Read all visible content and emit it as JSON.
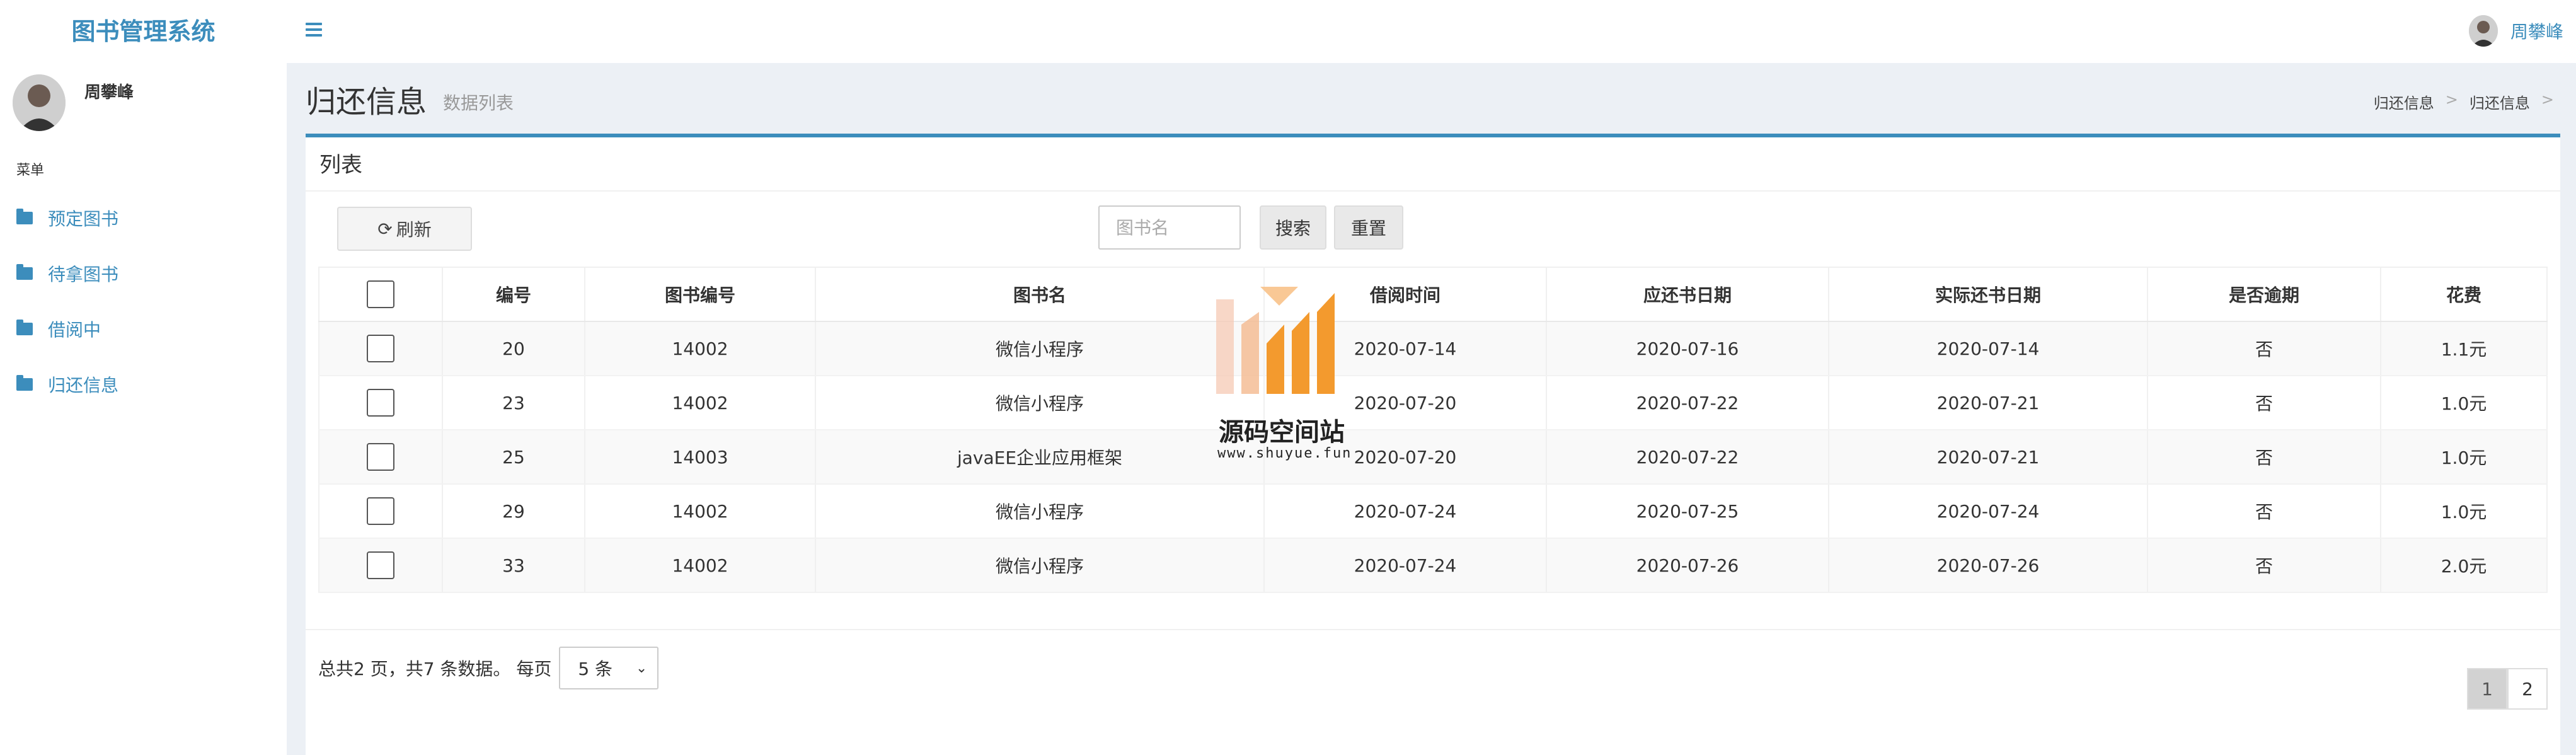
{
  "app": {
    "title": "图书管理系统"
  },
  "user": {
    "name": "周攀峰"
  },
  "sidebar": {
    "menu_header": "菜单",
    "items": [
      {
        "label": "预定图书",
        "icon": "folder-icon"
      },
      {
        "label": "待拿图书",
        "icon": "folder-icon"
      },
      {
        "label": "借阅中",
        "icon": "folder-icon"
      },
      {
        "label": "归还信息",
        "icon": "folder-icon"
      }
    ]
  },
  "header": {
    "title": "归还信息",
    "subtitle": "数据列表",
    "breadcrumb": [
      "归还信息",
      "归还信息"
    ],
    "breadcrumb_sep": ">"
  },
  "box": {
    "title": "列表",
    "refresh_label": "刷新",
    "search_placeholder": "图书名",
    "search_label": "搜索",
    "reset_label": "重置"
  },
  "table": {
    "columns": [
      "编号",
      "图书编号",
      "图书名",
      "借阅时间",
      "应还书日期",
      "实际还书日期",
      "是否逾期",
      "花费"
    ],
    "rows": [
      [
        "20",
        "14002",
        "微信小程序",
        "2020-07-14",
        "2020-07-16",
        "2020-07-14",
        "否",
        "1.1元"
      ],
      [
        "23",
        "14002",
        "微信小程序",
        "2020-07-20",
        "2020-07-22",
        "2020-07-21",
        "否",
        "1.0元"
      ],
      [
        "25",
        "14003",
        "javaEE企业应用框架",
        "2020-07-20",
        "2020-07-22",
        "2020-07-21",
        "否",
        "1.0元"
      ],
      [
        "29",
        "14002",
        "微信小程序",
        "2020-07-24",
        "2020-07-25",
        "2020-07-24",
        "否",
        "1.0元"
      ],
      [
        "33",
        "14002",
        "微信小程序",
        "2020-07-24",
        "2020-07-26",
        "2020-07-26",
        "否",
        "2.0元"
      ]
    ]
  },
  "pagination": {
    "summary": "总共2 页，共7 条数据。 每页",
    "page_size": "5 条",
    "pages": [
      "1",
      "2"
    ],
    "current": "1"
  },
  "watermark": {
    "text": "源码空间站",
    "url": "www.shuyue.fun"
  },
  "colors": {
    "accent": "#3c8dbc",
    "background": "#ecf0f5",
    "watermark_orange": "#f39a2e"
  }
}
